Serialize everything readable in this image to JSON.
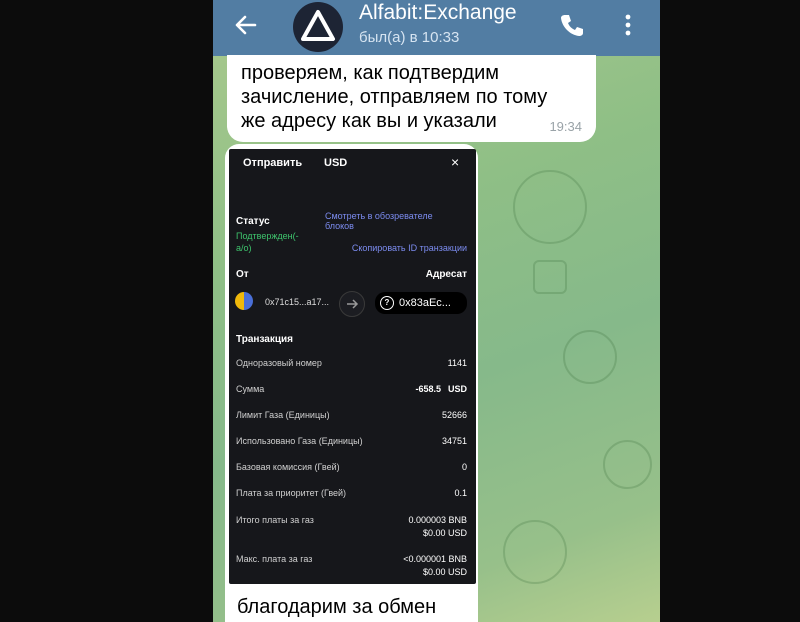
{
  "header": {
    "title": "Alfabit:Exchange",
    "status": "был(а) в 10:33",
    "back_icon": "arrow-left-icon",
    "call_icon": "phone-icon",
    "menu_icon": "vertical-dots-icon"
  },
  "messages": {
    "m1": {
      "text": "проверяем, как подтвердим зачисление, отправляем по тому же адресу как вы и указали",
      "time": "19:34"
    },
    "m2": {
      "text": "благодарим за обмен"
    }
  },
  "tx": {
    "title": "Отправить",
    "currency": "USD",
    "close": "×",
    "status_label": "Статус",
    "status_value": "Подтвержден(-а/о)",
    "explorer_link": "Смотреть в обозревателе блоков",
    "copy_link": "Скопировать ID транзакции",
    "from_label": "От",
    "to_label": "Адресат",
    "from_address": "0x71c15...a17...",
    "to_address": "0x83aEc...",
    "section_title": "Транзакция",
    "rows": [
      {
        "label": "Одноразовый номер",
        "value": "1141"
      },
      {
        "label": "Сумма",
        "value": "-658.5",
        "unit": "USD"
      },
      {
        "label": "Лимит Газа (Единицы)",
        "value": "52666"
      },
      {
        "label": "Использовано Газа (Единицы)",
        "value": "34751"
      },
      {
        "label": "Базовая комиссия (Гвей)",
        "value": "0"
      },
      {
        "label": "Плата за приоритет (Гвей)",
        "value": "0.1"
      },
      {
        "label": "Итого платы за газ",
        "value": "0.000003 BNB",
        "value2": "$0.00 USD"
      },
      {
        "label": "Макс. плата за газ",
        "value": "<0.000001 BNB",
        "value2": "$0.00 USD"
      }
    ]
  },
  "colors": {
    "header": "#527da3",
    "chat_bg": "#8fbf86",
    "status_green": "#3ec46d",
    "link_blue": "#7c8cf0"
  }
}
